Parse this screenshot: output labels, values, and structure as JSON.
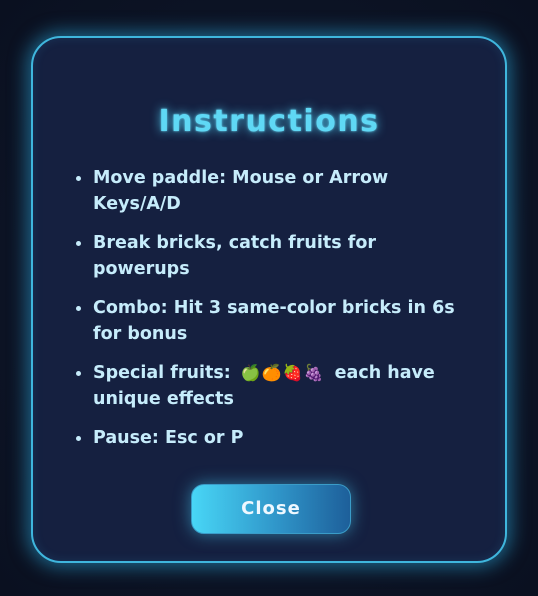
{
  "dialog": {
    "title": "Instructions",
    "items": [
      {
        "text": "Move paddle: Mouse or Arrow Keys/A/D"
      },
      {
        "text": "Break bricks, catch fruits for powerups"
      },
      {
        "text": "Combo: Hit 3 same-color bricks in 6s for bonus"
      },
      {
        "text_before": "Special fruits:",
        "fruit_icons": "🍏🍊🍓🍇",
        "text_after": "each have unique effects"
      },
      {
        "text": "Pause: Esc or P"
      }
    ],
    "close_label": "Close"
  },
  "colors": {
    "background": "#0d1426",
    "modal_fill": "#152040",
    "modal_border": "#3fb6dd",
    "title": "#5fd8f5",
    "text": "#c6ecfb",
    "button_gradient_start": "#48d6f6",
    "button_gradient_end": "#1d5f9a"
  }
}
